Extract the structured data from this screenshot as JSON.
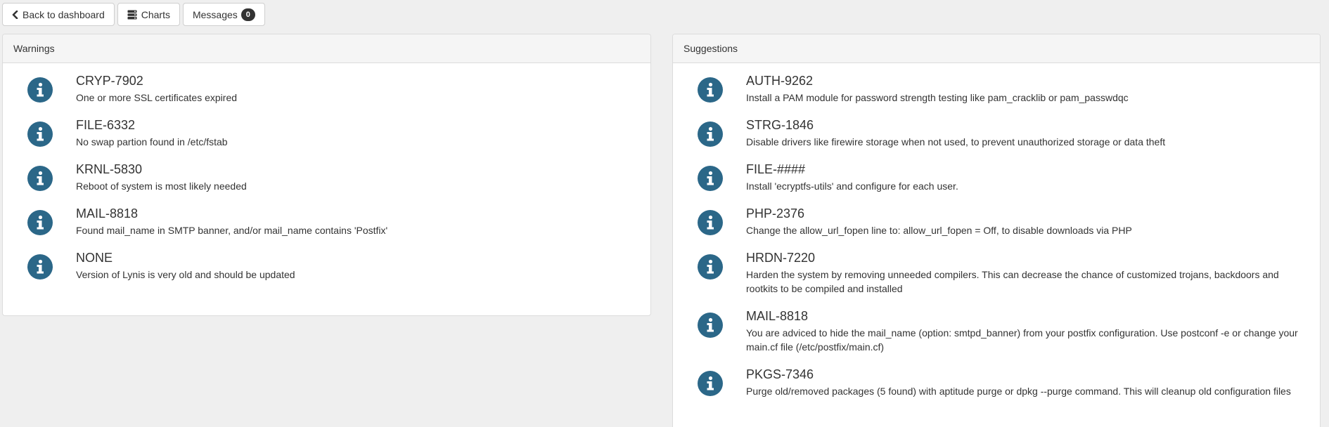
{
  "toolbar": {
    "back_label": "Back to dashboard",
    "charts_label": "Charts",
    "messages_label": "Messages",
    "messages_count": "0"
  },
  "warnings": {
    "heading": "Warnings",
    "items": [
      {
        "id": "CRYP-7902",
        "desc": "One or more SSL certificates expired"
      },
      {
        "id": "FILE-6332",
        "desc": "No swap partion found in /etc/fstab"
      },
      {
        "id": "KRNL-5830",
        "desc": "Reboot of system is most likely needed"
      },
      {
        "id": "MAIL-8818",
        "desc": "Found mail_name in SMTP banner, and/or mail_name contains 'Postfix'"
      },
      {
        "id": "NONE",
        "desc": "Version of Lynis is very old and should be updated"
      }
    ]
  },
  "suggestions": {
    "heading": "Suggestions",
    "items": [
      {
        "id": "AUTH-9262",
        "desc": "Install a PAM module for password strength testing like pam_cracklib or pam_passwdqc"
      },
      {
        "id": "STRG-1846",
        "desc": "Disable drivers like firewire storage when not used, to prevent unauthorized storage or data theft"
      },
      {
        "id": "FILE-####",
        "desc": "Install 'ecryptfs-utils' and configure for each user."
      },
      {
        "id": "PHP-2376",
        "desc": "Change the allow_url_fopen line to: allow_url_fopen = Off, to disable downloads via PHP"
      },
      {
        "id": "HRDN-7220",
        "desc": "Harden the system by removing unneeded compilers. This can decrease the chance of customized trojans, backdoors and rootkits to be compiled and installed"
      },
      {
        "id": "MAIL-8818",
        "desc": "You are adviced to hide the mail_name (option: smtpd_banner) from your postfix configuration. Use postconf -e or change your main.cf file (/etc/postfix/main.cf)"
      },
      {
        "id": "PKGS-7346",
        "desc": "Purge old/removed packages (5 found) with aptitude purge or dpkg --purge command. This will cleanup old configuration files"
      }
    ]
  },
  "icons": {
    "back": "chevron-left-icon",
    "charts": "server-stack-icon",
    "item": "info-circle-icon"
  },
  "colors": {
    "info_icon": "#2b6788",
    "badge": "#333333",
    "background": "#efefef"
  }
}
